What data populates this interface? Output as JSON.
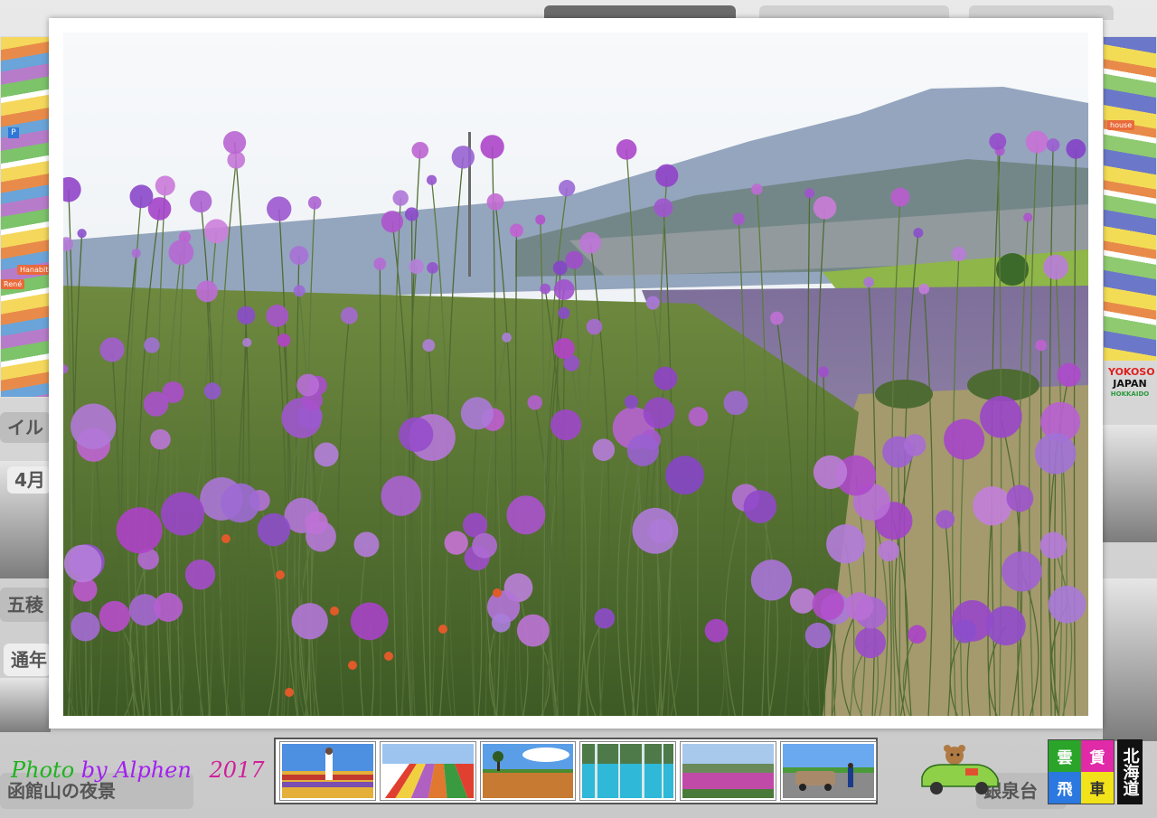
{
  "background": {
    "title_text": "  　　　　",
    "side_buttons": [
      {
        "label": "イル"
      },
      {
        "label": "4月"
      },
      {
        "label": "五稜"
      },
      {
        "label": "通年"
      },
      {
        "label": "函館山の夜景"
      },
      {
        "label": "銀泉台"
      }
    ]
  },
  "map_labels": {
    "left_tag_1": "Hanabito",
    "left_tag_2": "René",
    "right_tag": "house",
    "parking": "P"
  },
  "logo": {
    "line1": "YOKOSO",
    "line2": "JAPAN",
    "line3": "HOKKAIDO"
  },
  "credit": {
    "part1": "Photo",
    "part2": "by Alphen",
    "year": "2017"
  },
  "thumbnails": [
    {
      "icon": "person-in-flower-field-thumb"
    },
    {
      "icon": "striped-flower-fields-thumb"
    },
    {
      "icon": "wheat-field-tree-thumb"
    },
    {
      "icon": "blue-pond-thumb"
    },
    {
      "icon": "pink-flowers-thumb"
    },
    {
      "icon": "car-on-road-thumb"
    }
  ],
  "grid_logo": {
    "cells": [
      "雲",
      "賃",
      "飛",
      "車"
    ],
    "colors": [
      "#2aa52a",
      "#e02aa8",
      "#2a78e0",
      "#f2e21a"
    ]
  },
  "hokkaido_tag": "北海道",
  "colors": {
    "frame": "#ffffff",
    "verbena": "#9a5fd0",
    "lavender_field": "#8a78a8",
    "sky": "#eef2f6"
  }
}
